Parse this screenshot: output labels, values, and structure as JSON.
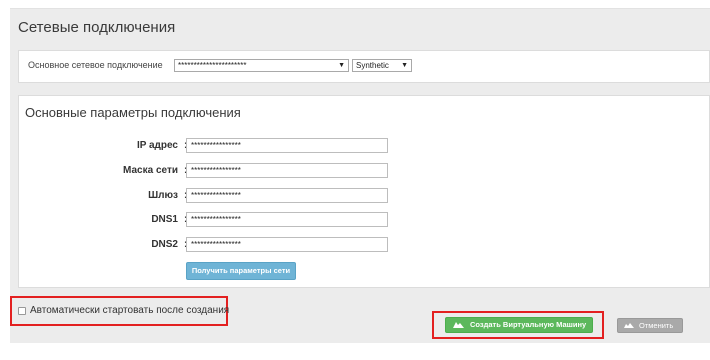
{
  "network": {
    "title": "Сетевые подключения",
    "primary_connection_label": "Основное сетевое подключение",
    "primary_connection_value": "**********************",
    "adapter_type_value": "Synthetic"
  },
  "params": {
    "title": "Основные параметры подключения",
    "fields": [
      {
        "label": "IP адрес",
        "value": "****************"
      },
      {
        "label": "Маска сети",
        "value": "****************"
      },
      {
        "label": "Шлюз",
        "value": "****************"
      },
      {
        "label": "DNS1",
        "value": "****************"
      },
      {
        "label": "DNS2",
        "value": "****************"
      }
    ],
    "separator": ":",
    "get_params_button": "Получить параметры сети"
  },
  "footer": {
    "autostart_label": "Автоматически стартовать после создания",
    "autostart_checked": false,
    "create_button": "Создать Виртуальную Машину",
    "cancel_button": "Отменить"
  },
  "colors": {
    "primary_button": "#5cb85c",
    "info_button": "#6fb4d6",
    "cancel_button": "#a9a9a9",
    "highlight": "#e32020"
  },
  "icons": {
    "create": "cloud-icon",
    "cancel": "cloud-icon"
  }
}
